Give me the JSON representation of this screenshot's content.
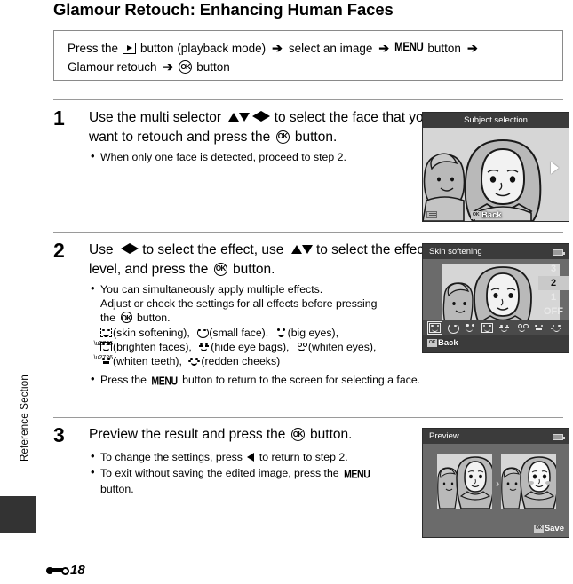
{
  "page": {
    "title": "Glamour Retouch: Enhancing Human Faces",
    "sidebar_label": "Reference Section",
    "footer_number": "18",
    "footer_symbol": "reference-section-symbol"
  },
  "intro": {
    "line1_part1": "Press the",
    "line1_icon": "playback-button-icon",
    "line1_part2": "button (playback mode)",
    "arrow": "➔",
    "line1_part3": "select an image",
    "line1_menu": "MENU",
    "line1_part4": "button",
    "line2_part1": "Glamour retouch",
    "line2_ok": "ok-button-icon",
    "line2_part2": "button"
  },
  "steps": [
    {
      "number": "1",
      "head_part1": "Use the multi selector",
      "head_arrows": "▲▼◀▶",
      "head_part2": "to select the face that you want to retouch and press the",
      "head_ok": "ok-button-icon",
      "head_part3": "button.",
      "bullets": [
        "When only one face is detected, proceed to step 2."
      ]
    },
    {
      "number": "2",
      "head_part1": "Use",
      "head_arrows_lr": "◀▶",
      "head_part2": "to select the effect, use",
      "head_arrows_ud": "▲▼",
      "head_part3": "to select the effect level, and press the",
      "head_ok": "ok-button-icon",
      "head_part4": "button.",
      "bullet1_line1": "You can simultaneously apply multiple effects.",
      "bullet1_line2": "Adjust or check the settings for all effects before pressing",
      "bullet1_line3_pre": "the",
      "bullet1_line3_post": "button.",
      "effects_line1": [
        {
          "icon": "skin-softening-icon",
          "label": "(skin softening),"
        },
        {
          "icon": "small-face-icon",
          "label": "(small face),"
        },
        {
          "icon": "big-eyes-icon",
          "label": "(big eyes),"
        }
      ],
      "effects_line2": [
        {
          "icon": "brighten-faces-icon",
          "label": "(brighten faces),"
        },
        {
          "icon": "hide-eye-bags-icon",
          "label": "(hide eye bags),"
        },
        {
          "icon": "whiten-eyes-icon",
          "label": "(whiten eyes),"
        }
      ],
      "effects_line3": [
        {
          "icon": "whiten-teeth-icon",
          "label": "(whiten teeth),"
        },
        {
          "icon": "redden-cheeks-icon",
          "label": "(redden cheeks)"
        }
      ],
      "bullet2_pre": "Press the",
      "bullet2_menu": "MENU",
      "bullet2_post": "button to return to the screen for selecting a face."
    },
    {
      "number": "3",
      "head_part1": "Preview the result and press the",
      "head_ok": "ok-button-icon",
      "head_part2": "button.",
      "bullet1_pre": "To change the settings, press",
      "bullet1_arrow": "◀",
      "bullet1_post": "to return to step 2.",
      "bullet2_pre": "To exit without saving the edited image, press the",
      "bullet2_menu": "MENU",
      "bullet2_post": "button."
    }
  ],
  "screens": {
    "screen1": {
      "title": "Subject selection",
      "back_label": "Back",
      "back_key": "OK",
      "nav_arrow": "right-arrow-icon",
      "menu_chip": "menu-chip-icon"
    },
    "screen2": {
      "title": "Skin softening",
      "battery": "battery-icon",
      "levels": [
        "3",
        "2",
        "1",
        "OFF"
      ],
      "selected_level": "2",
      "back_label": "Back",
      "back_key": "OK",
      "effect_icons": [
        "skin-softening-icon",
        "small-face-icon",
        "big-eyes-icon",
        "brighten-faces-icon",
        "hide-eye-bags-icon",
        "whiten-eyes-icon",
        "whiten-teeth-icon",
        "redden-cheeks-icon"
      ],
      "active_effect": "skin-softening-icon"
    },
    "screen3": {
      "title": "Preview",
      "battery": "battery-icon",
      "save_label": "Save",
      "save_key": "OK",
      "compare_arrow": "›"
    }
  },
  "colors": {
    "screen_bg": "#6b6b6b",
    "screen_title_bg": "#3b3b3b",
    "photo_bg": "#d6d6d6",
    "selected_level_bg": "#c9c9c9",
    "divider": "#9a9a9a",
    "sidebar_block": "#333333"
  }
}
